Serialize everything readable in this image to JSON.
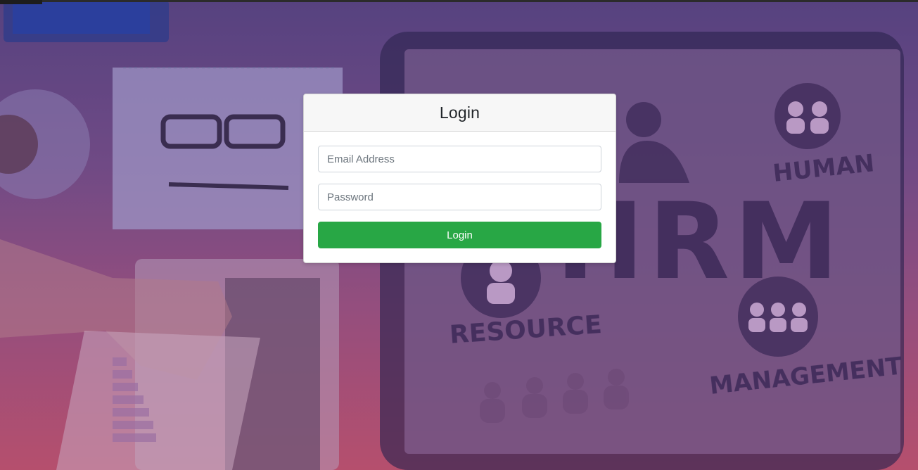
{
  "background": {
    "overlay_colors": [
      "#4a3f86",
      "#9c4f84",
      "#c9506e"
    ],
    "tablet_words": [
      "HUMAN",
      "RESOURCE",
      "MANAGEMENT",
      "HRM"
    ]
  },
  "login_card": {
    "title": "Login",
    "email": {
      "placeholder": "Email Address",
      "value": ""
    },
    "password": {
      "placeholder": "Password",
      "value": ""
    },
    "submit_label": "Login",
    "button_color": "#28a745"
  }
}
